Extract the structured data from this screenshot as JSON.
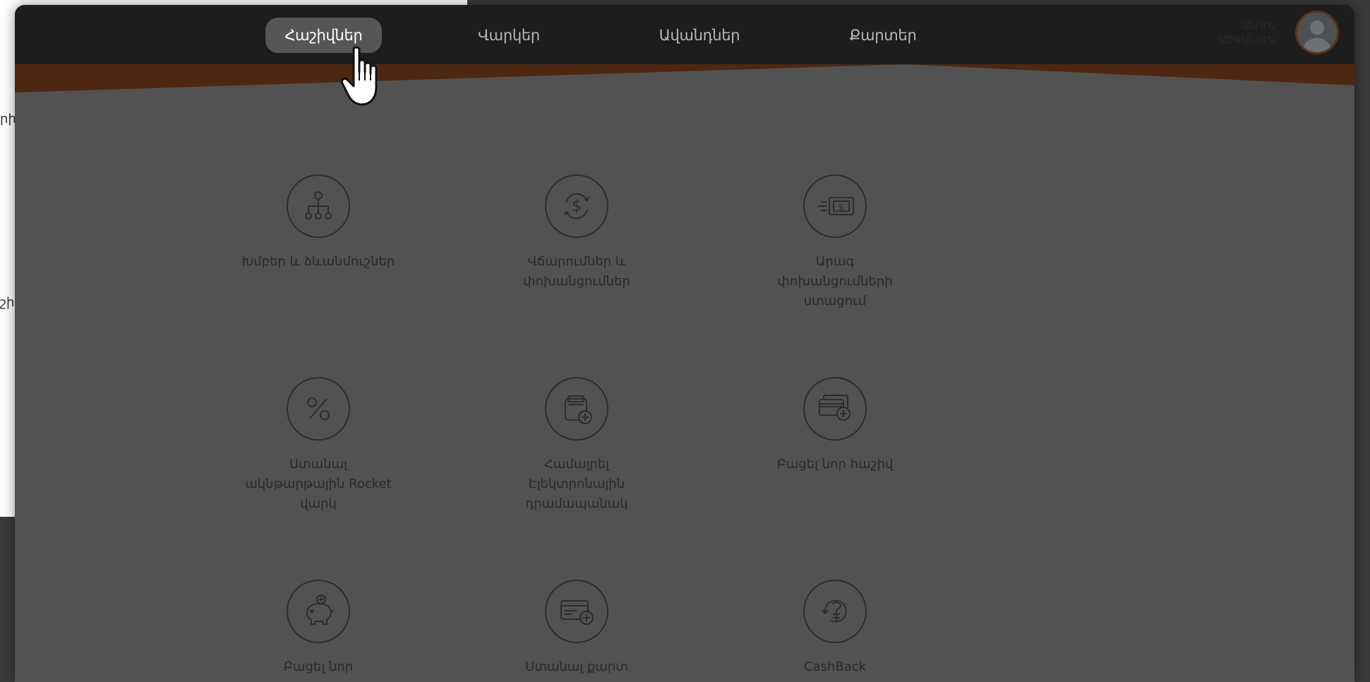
{
  "background": {
    "edge_text_1": "րի",
    "edge_text_2": "շիվ"
  },
  "nav": {
    "tabs": [
      {
        "label": "Հաշիվներ",
        "active": true
      },
      {
        "label": "Վարկեր",
        "active": false
      },
      {
        "label": "Ավանդներ",
        "active": false
      },
      {
        "label": "Քարտեր",
        "active": false
      }
    ]
  },
  "user": {
    "name_line1": "ԱՆՈՒՆ",
    "name_line2": "ԱԶԳԱՆՈՒՆ",
    "avatar_icon": "user-avatar-icon"
  },
  "colors": {
    "topbar": "#1d1d1d",
    "accent_brown": "#4e2710",
    "content_bg": "#525252",
    "active_tab_bg": "#565656"
  },
  "services": [
    {
      "label": "Խմբեր և ձևանմուշներ",
      "icon": "hierarchy-icon"
    },
    {
      "label": "Վճարումներ և փոխանցումներ",
      "icon": "dollar-exchange-icon"
    },
    {
      "label": "Արագ փոխանցումների ստացում",
      "icon": "fast-money-icon"
    },
    {
      "label": "Ստանալ ակնթարթային Rocket վարկ",
      "icon": "percent-icon"
    },
    {
      "label": "Համալրել Էլեկտրոնային դրամապանակ",
      "icon": "wallet-add-icon"
    },
    {
      "label": "Բացել նոր հաշիվ",
      "icon": "cards-add-icon"
    },
    {
      "label": "Բացել նոր",
      "icon": "piggy-bank-icon"
    },
    {
      "label": "Ստանալ քարտ",
      "icon": "card-add-icon"
    },
    {
      "label": "CashBack",
      "icon": "cashback-dram-icon"
    }
  ]
}
